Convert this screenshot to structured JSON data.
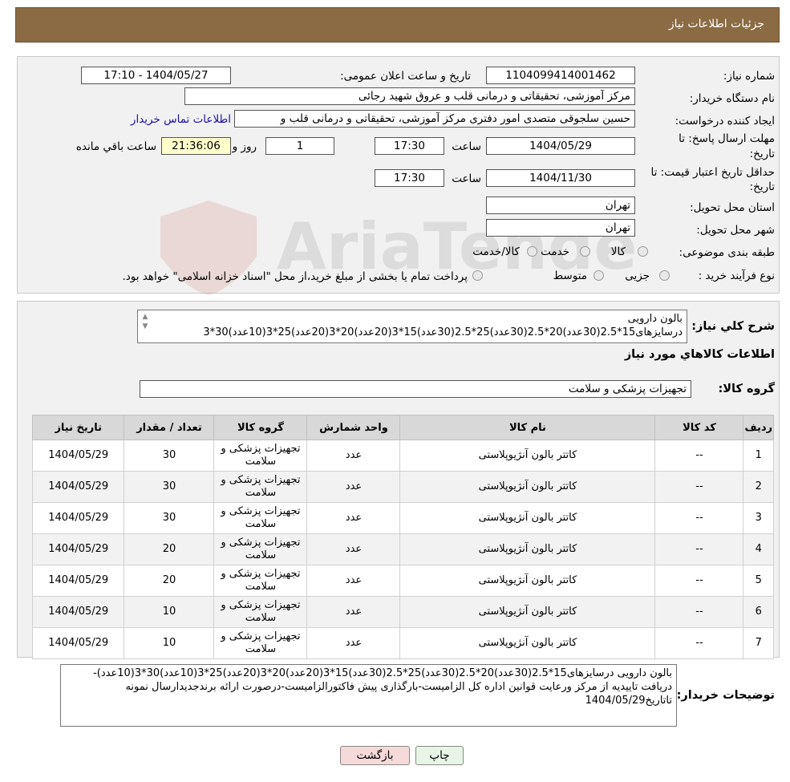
{
  "header": {
    "title": "جزئیات اطلاعات نیاز"
  },
  "info": {
    "need_number_label": "شماره نیاز:",
    "need_number": "1104099414001462",
    "announce_label": "تاریخ و ساعت اعلان عمومی:",
    "announce_value": "1404/05/27 - 17:10",
    "buyer_org_label": "نام دستگاه خریدار:",
    "buyer_org": "مرکز آموزشی، تحقیقاتی و درمانی قلب و عروق شهید رجائی",
    "creator_label": "ایجاد کننده درخواست:",
    "creator": "حسین سلجوقی متصدی امور دفتری مرکز آموزشی، تحقیقاتی و درمانی قلب و",
    "contact_link": "اطلاعات تماس خریدار",
    "deadline_label_line1": "مهلت ارسال پاسخ: تا",
    "deadline_label_line2": "تاریخ:",
    "deadline_date": "1404/05/29",
    "time_label": "ساعت",
    "deadline_time": "17:30",
    "days": "1",
    "days_label": "روز و",
    "remaining": "21:36:06",
    "remaining_label": "ساعت باقي مانده",
    "validity_label_line1": "حداقل تاریخ اعتبار قیمت: تا",
    "validity_label_line2": "تاریخ:",
    "validity_date": "1404/11/30",
    "validity_time": "17:30",
    "province_label": "استان محل تحویل:",
    "province": "تهران",
    "city_label": "شهر محل تحویل:",
    "city": "تهران",
    "category_label": "طبقه بندی موضوعی:",
    "category_options": [
      "کالا",
      "خدمت",
      "کالا/خدمت"
    ],
    "process_label": "نوع فرآیند خرید :",
    "process_options": [
      "جزیی",
      "متوسط"
    ],
    "process_note": "پرداخت تمام یا بخشی از مبلغ خرید،از محل \"اسناد خزانه اسلامی\" خواهد بود."
  },
  "summary": {
    "label": "شرح کلي نياز:",
    "line1": "بالون دارویی",
    "line2": "درسایزهای15*2.5(30عدد)20*2.5(30عدد)25*2.5(30عدد)15*3(20عدد)20*3(20عدد)25*3(10عدد)30*3"
  },
  "goods": {
    "section_title": "اطلاعات کالاهاي مورد نياز",
    "group_label": "گروه کالا:",
    "group_value": "تجهیزات پزشکی و سلامت",
    "columns": [
      "ردیف",
      "کد کالا",
      "نام کالا",
      "واحد شمارش",
      "گروه کالا",
      "تعداد / مقدار",
      "تاریخ نیاز"
    ],
    "rows": [
      {
        "idx": "1",
        "code": "--",
        "name": "کاتتر بالون آنژیوپلاستی",
        "unit": "عدد",
        "group": "تجهیزات پزشکی و سلامت",
        "qty": "30",
        "date": "1404/05/29"
      },
      {
        "idx": "2",
        "code": "--",
        "name": "کاتتر بالون آنژیوپلاستی",
        "unit": "عدد",
        "group": "تجهیزات پزشکی و سلامت",
        "qty": "30",
        "date": "1404/05/29"
      },
      {
        "idx": "3",
        "code": "--",
        "name": "کاتتر بالون آنژیوپلاستی",
        "unit": "عدد",
        "group": "تجهیزات پزشکی و سلامت",
        "qty": "30",
        "date": "1404/05/29"
      },
      {
        "idx": "4",
        "code": "--",
        "name": "کاتتر بالون آنژیوپلاستی",
        "unit": "عدد",
        "group": "تجهیزات پزشکی و سلامت",
        "qty": "20",
        "date": "1404/05/29"
      },
      {
        "idx": "5",
        "code": "--",
        "name": "کاتتر بالون آنژیوپلاستی",
        "unit": "عدد",
        "group": "تجهیزات پزشکی و سلامت",
        "qty": "20",
        "date": "1404/05/29"
      },
      {
        "idx": "6",
        "code": "--",
        "name": "کاتتر بالون آنژیوپلاستی",
        "unit": "عدد",
        "group": "تجهیزات پزشکی و سلامت",
        "qty": "10",
        "date": "1404/05/29"
      },
      {
        "idx": "7",
        "code": "--",
        "name": "کاتتر بالون آنژیوپلاستی",
        "unit": "عدد",
        "group": "تجهیزات پزشکی و سلامت",
        "qty": "10",
        "date": "1404/05/29"
      }
    ]
  },
  "buyer_notes": {
    "label": "توضیحات خریدار:",
    "text": "بالون دارویی درسایزهای15*2.5(30عدد)20*2.5(30عدد)25*2.5(30عدد)15*3(20عدد)20*3(20عدد)25*3(10عدد)30*3(10عدد)-دریافت تاییدیه از مرکز ورعایت قوانین اداره کل الزامیست-بارگذاری پیش فاکتورالزامیست-درصورت ارائه برندجدیدارسال نمونه تاتاریخ1404/05/29"
  },
  "buttons": {
    "print": "چاپ",
    "back": "بازگشت"
  },
  "watermark": {
    "text": "AriaTender.neT"
  },
  "colors": {
    "header": "#8b6b43",
    "back_button": "#f6d9d9",
    "print_button": "#e6f5e6",
    "link": "#1a0dab"
  }
}
